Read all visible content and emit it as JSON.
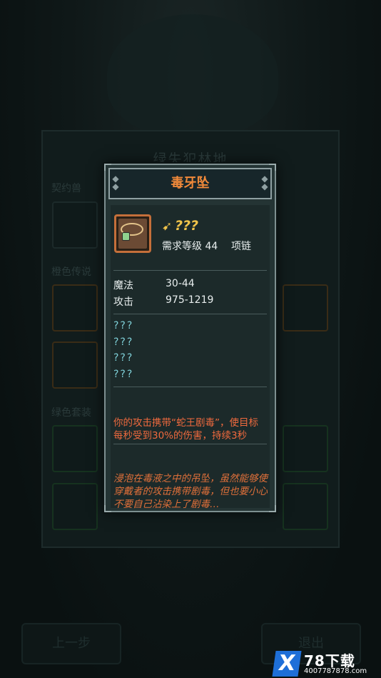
{
  "background": {
    "panel_title": "绿失犯林地",
    "sections": [
      "契约兽",
      "橙色传说",
      "绿色套装"
    ],
    "buttons": {
      "prev": "上一步",
      "exit": "退出"
    }
  },
  "dialog": {
    "title": "毒牙坠",
    "item": {
      "name": "???",
      "requirement": "需求等级 44",
      "slot_type": "项链",
      "icon": "necklace-icon",
      "type_icon": "boot-icon"
    },
    "stats": [
      {
        "label": "魔法",
        "value": "30-44"
      },
      {
        "label": "攻击",
        "value": "975-1219"
      }
    ],
    "unknown_attributes": [
      "???",
      "???",
      "???",
      "???"
    ],
    "effect": "你的攻击携带“蛇王剧毒”，使目标每秒受到30%的伤害，持续3秒",
    "lore": "浸泡在毒液之中的吊坠，虽然能够使穿戴者的攻击携带剧毒，但也要小心不要自己沾染上了剧毒…"
  },
  "watermark": {
    "brand": "78下载",
    "sub": "4007787878.com",
    "logo": "X"
  },
  "colors": {
    "title_orange": "#f28a3a",
    "name_gold": "#f0c34a",
    "unknown_cyan": "#7fd0d8",
    "effect_red": "#f06a3e"
  }
}
